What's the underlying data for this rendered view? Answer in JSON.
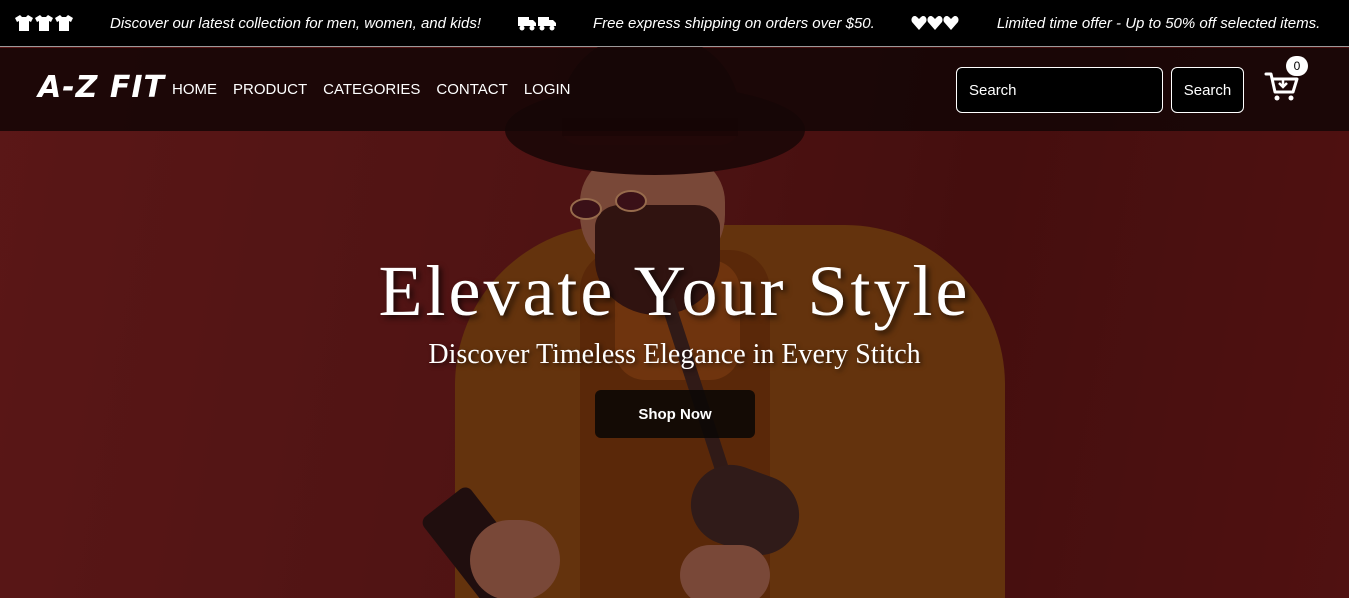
{
  "announcement": {
    "items": [
      {
        "icon": "tshirts-icon",
        "text": "Discover our latest collection for men, women, and kids!"
      },
      {
        "icon": "delivery-trucks-icon",
        "text": "Free express shipping on orders over $50."
      },
      {
        "icon": "hearts-icon",
        "text": "Limited time offer - Up to 50% off selected items."
      }
    ]
  },
  "navbar": {
    "brand": "A-Z FIT",
    "links": [
      "HOME",
      "PRODUCT",
      "CATEGORIES",
      "CONTACT",
      "LOGIN"
    ],
    "search": {
      "placeholder": "Search",
      "button_label": "Search"
    },
    "cart": {
      "icon": "shopping-cart-icon",
      "count": "0"
    }
  },
  "hero": {
    "title": "Elevate Your Style",
    "subtitle": "Discover Timeless Elegance in Every Stitch",
    "cta_label": "Shop Now"
  },
  "colors": {
    "background": "#5a1a1a",
    "announcement_bar": "#000000",
    "navbar": "#140606",
    "text": "#ffffff",
    "cta_button": "#0c0806"
  }
}
